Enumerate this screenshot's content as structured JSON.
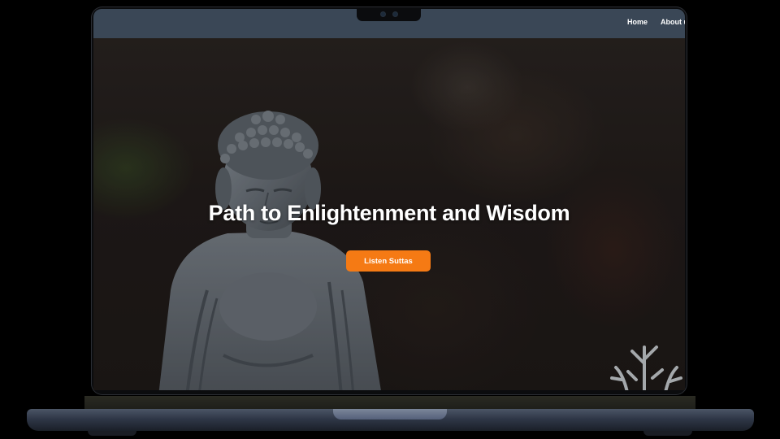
{
  "nav": {
    "items": [
      {
        "label": "Home"
      },
      {
        "label": "About u"
      }
    ]
  },
  "hero": {
    "title": "Path to Enlightenment and Wisdom",
    "button_label": "Listen Suttas"
  },
  "colors": {
    "header_bg": "#3a4756",
    "accent": "#f57a14",
    "title_text": "#ffffff"
  }
}
